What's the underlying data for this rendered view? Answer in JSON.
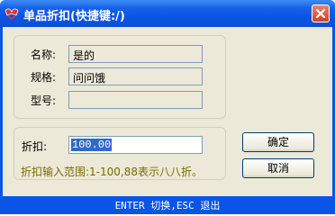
{
  "window": {
    "title": "单品折扣(快捷键:/)",
    "close_label": "×"
  },
  "info": {
    "name_label": "名称:",
    "name_value": "是的",
    "spec_label": "规格:",
    "spec_value": "问问饿",
    "model_label": "型号:",
    "model_value": ""
  },
  "discount": {
    "label": "折扣:",
    "value": "100.00",
    "hint": "折扣输入范围:1-100,88表示八八折。"
  },
  "buttons": {
    "confirm": "确定",
    "cancel": "取消"
  },
  "status": {
    "text": "ENTER 切换,ESC 退出"
  },
  "icons": {
    "app": "app-logo-icon",
    "close": "close-icon"
  },
  "colors": {
    "titlebar": "#0a55e5",
    "hint_text": "#7a6a00",
    "selection": "#316ac5"
  }
}
